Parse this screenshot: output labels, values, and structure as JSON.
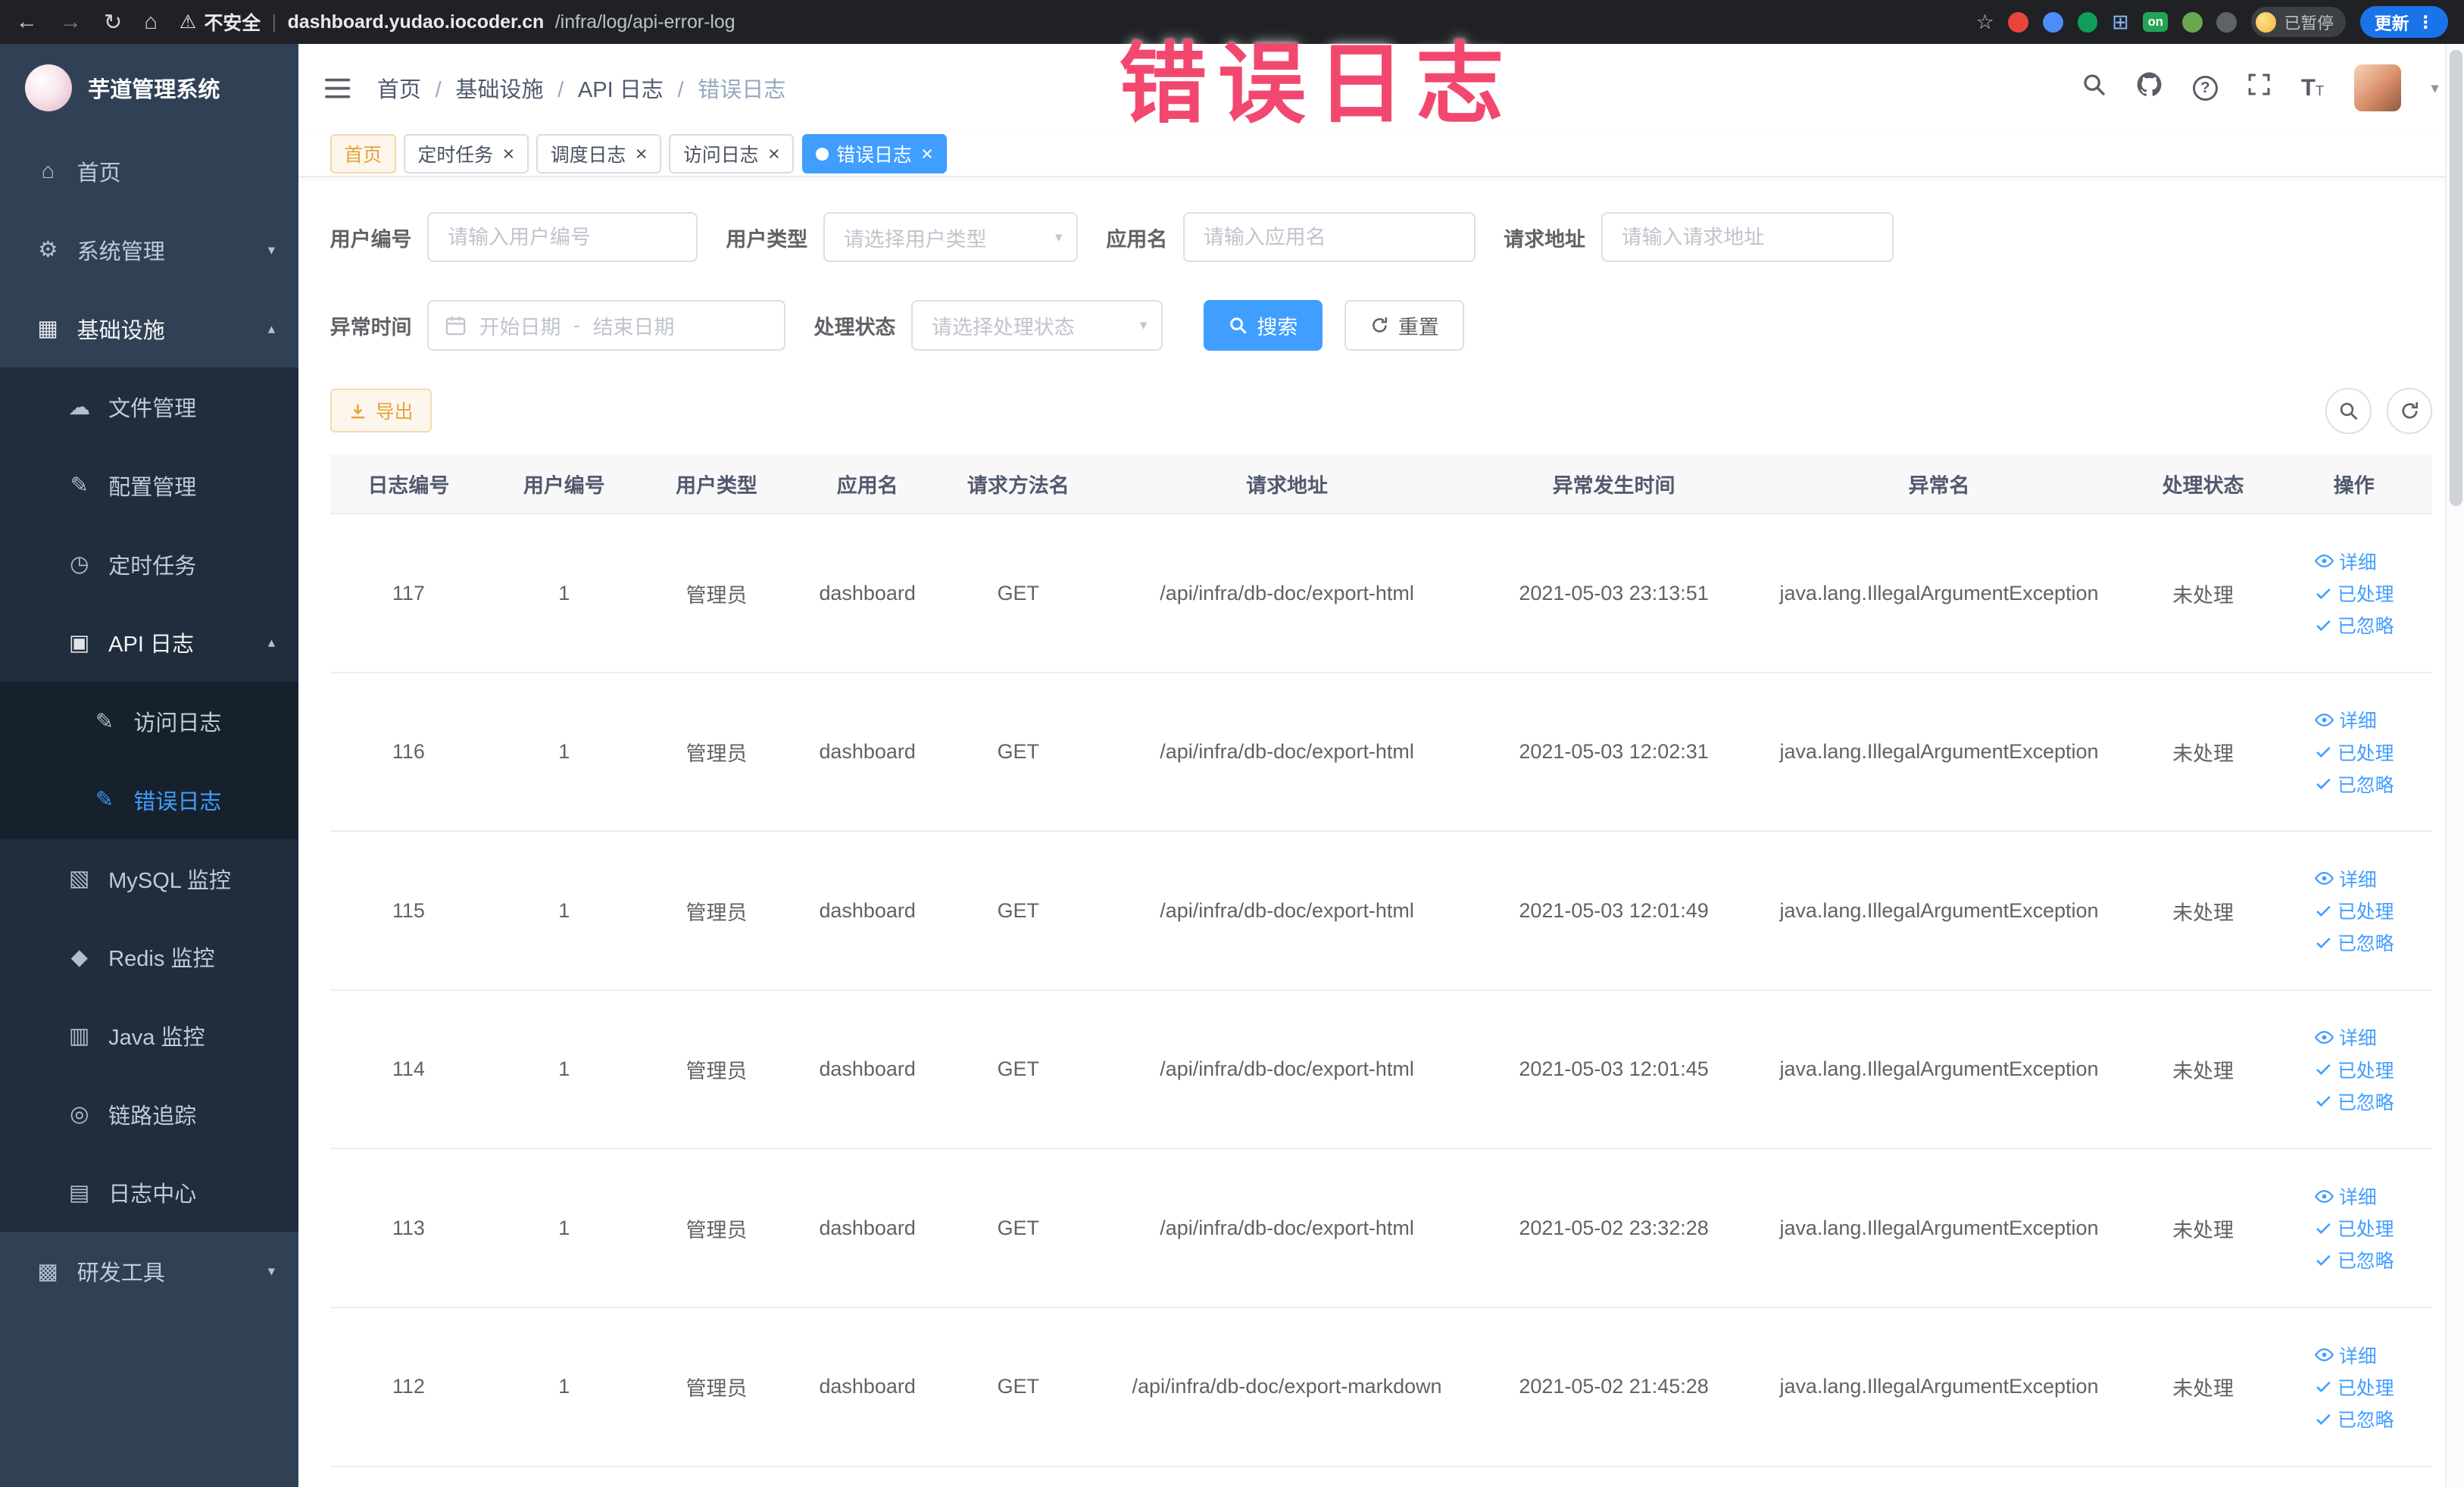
{
  "browser": {
    "security_label": "不安全",
    "url_host": "dashboard.yudao.iocoder.cn",
    "url_path": "/infra/log/api-error-log",
    "on_badge": "on",
    "paused_label": "已暂停",
    "update_label": "更新"
  },
  "icons": {
    "back": "←",
    "forward": "→",
    "reload": "↻",
    "home": "⌂",
    "warning": "⚠",
    "star": "☆",
    "grid": "⊞",
    "more": "⋮",
    "caret_down": "▾",
    "help": "?",
    "font_large": "T",
    "font_small": "T",
    "close": "×"
  },
  "overlay": {
    "title": "错误日志"
  },
  "sidebar": {
    "logo_title": "芋道管理系统",
    "items": [
      {
        "name": "sidebar-item-home",
        "icon": "home-icon",
        "glyph": "⌂",
        "label": "首页",
        "level": 1
      },
      {
        "name": "sidebar-item-system-management",
        "icon": "gear-icon",
        "glyph": "⚙",
        "label": "系统管理",
        "level": 1,
        "chevron": "▾"
      },
      {
        "name": "sidebar-item-infrastructure",
        "icon": "infrastructure-icon",
        "glyph": "▦",
        "label": "基础设施",
        "level": 1,
        "chevron": "▴",
        "bright": true
      },
      {
        "name": "sidebar-item-file-management",
        "icon": "cloud-file-icon",
        "glyph": "☁",
        "label": "文件管理",
        "level": 2
      },
      {
        "name": "sidebar-item-config-management",
        "icon": "edit-config-icon",
        "glyph": "✎",
        "label": "配置管理",
        "level": 2
      },
      {
        "name": "sidebar-item-scheduled-tasks",
        "icon": "timer-icon",
        "glyph": "◷",
        "label": "定时任务",
        "level": 2
      },
      {
        "name": "sidebar-item-api-logs",
        "icon": "api-log-icon",
        "glyph": "▣",
        "label": "API 日志",
        "level": 2,
        "chevron": "▴",
        "bright": true
      },
      {
        "name": "sidebar-item-access-logs",
        "icon": "access-log-icon",
        "glyph": "✎",
        "label": "访问日志",
        "level": 3
      },
      {
        "name": "sidebar-item-error-logs",
        "icon": "error-log-icon",
        "glyph": "✎",
        "label": "错误日志",
        "level": 3,
        "active": true
      },
      {
        "name": "sidebar-item-mysql-monitor",
        "icon": "mysql-monitor-icon",
        "glyph": "▧",
        "label": "MySQL 监控",
        "level": 2
      },
      {
        "name": "sidebar-item-redis-monitor",
        "icon": "redis-monitor-icon",
        "glyph": "◆",
        "label": "Redis 监控",
        "level": 2
      },
      {
        "name": "sidebar-item-java-monitor",
        "icon": "java-monitor-icon",
        "glyph": "▥",
        "label": "Java 监控",
        "level": 2
      },
      {
        "name": "sidebar-item-trace",
        "icon": "trace-icon",
        "glyph": "◎",
        "label": "链路追踪",
        "level": 2
      },
      {
        "name": "sidebar-item-log-center",
        "icon": "log-center-icon",
        "glyph": "▤",
        "label": "日志中心",
        "level": 2
      },
      {
        "name": "sidebar-item-dev-tools",
        "icon": "toolbox-icon",
        "glyph": "▩",
        "label": "研发工具",
        "level": 1,
        "chevron": "▾"
      }
    ]
  },
  "header": {
    "breadcrumb": [
      {
        "label": "首页"
      },
      {
        "label": "基础设施"
      },
      {
        "label": "API 日志"
      },
      {
        "label": "错误日志",
        "muted": true
      }
    ]
  },
  "tabs": [
    {
      "label": "首页",
      "closable": false,
      "active": false,
      "variant": "affix"
    },
    {
      "label": "定时任务",
      "closable": true,
      "active": false
    },
    {
      "label": "调度日志",
      "closable": true,
      "active": false
    },
    {
      "label": "访问日志",
      "closable": true,
      "active": false
    },
    {
      "label": "错误日志",
      "closable": true,
      "active": true
    }
  ],
  "filters": {
    "user_id_label": "用户编号",
    "user_id_placeholder": "请输入用户编号",
    "user_type_label": "用户类型",
    "user_type_placeholder": "请选择用户类型",
    "app_name_label": "应用名",
    "app_name_placeholder": "请输入应用名",
    "request_url_label": "请求地址",
    "request_url_placeholder": "请输入请求地址",
    "exception_time_label": "异常时间",
    "start_date_placeholder": "开始日期",
    "date_separator": "-",
    "end_date_placeholder": "结束日期",
    "process_status_label": "处理状态",
    "process_status_placeholder": "请选择处理状态",
    "search_label": "搜索",
    "reset_label": "重置"
  },
  "toolbar": {
    "export_label": "导出"
  },
  "table": {
    "headers": [
      "日志编号",
      "用户编号",
      "用户类型",
      "应用名",
      "请求方法名",
      "请求地址",
      "异常发生时间",
      "异常名",
      "处理状态",
      "操作"
    ],
    "actions": [
      "详细",
      "已处理",
      "已忽略"
    ],
    "rows": [
      {
        "id": "117",
        "user_id": "1",
        "user_type": "管理员",
        "app": "dashboard",
        "method": "GET",
        "url": "/api/infra/db-doc/export-html",
        "time": "2021-05-03 23:13:51",
        "exception": "java.lang.IllegalArgumentException",
        "status": "未处理"
      },
      {
        "id": "116",
        "user_id": "1",
        "user_type": "管理员",
        "app": "dashboard",
        "method": "GET",
        "url": "/api/infra/db-doc/export-html",
        "time": "2021-05-03 12:02:31",
        "exception": "java.lang.IllegalArgumentException",
        "status": "未处理"
      },
      {
        "id": "115",
        "user_id": "1",
        "user_type": "管理员",
        "app": "dashboard",
        "method": "GET",
        "url": "/api/infra/db-doc/export-html",
        "time": "2021-05-03 12:01:49",
        "exception": "java.lang.IllegalArgumentException",
        "status": "未处理"
      },
      {
        "id": "114",
        "user_id": "1",
        "user_type": "管理员",
        "app": "dashboard",
        "method": "GET",
        "url": "/api/infra/db-doc/export-html",
        "time": "2021-05-03 12:01:45",
        "exception": "java.lang.IllegalArgumentException",
        "status": "未处理"
      },
      {
        "id": "113",
        "user_id": "1",
        "user_type": "管理员",
        "app": "dashboard",
        "method": "GET",
        "url": "/api/infra/db-doc/export-html",
        "time": "2021-05-02 23:32:28",
        "exception": "java.lang.IllegalArgumentException",
        "status": "未处理"
      },
      {
        "id": "112",
        "user_id": "1",
        "user_type": "管理员",
        "app": "dashboard",
        "method": "GET",
        "url": "/api/infra/db-doc/export-markdown",
        "time": "2021-05-02 21:45:28",
        "exception": "java.lang.IllegalArgumentException",
        "status": "未处理"
      }
    ]
  }
}
